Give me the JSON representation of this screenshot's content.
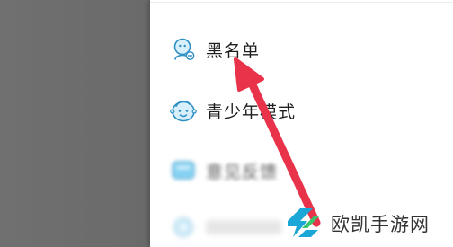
{
  "menu": {
    "items": [
      {
        "label": "黑名单",
        "icon": "blacklist-person-icon"
      },
      {
        "label": "青少年模式",
        "icon": "teen-mode-face-icon"
      },
      {
        "label": "意见反馈",
        "icon": "feedback-icon"
      },
      {
        "label": "",
        "icon": "settings-icon"
      }
    ]
  },
  "annotation": {
    "color": "#e8334a",
    "icon": "red-arrow-pointer"
  },
  "watermark": {
    "text": "欧凯手游网",
    "logo_color": "#1aa6d6",
    "logo_accent": "#3bc36c"
  },
  "colors": {
    "dim_overlay": "#6e6e6e",
    "panel_bg": "#ffffff",
    "icon_blue": "#4cb8e8"
  }
}
